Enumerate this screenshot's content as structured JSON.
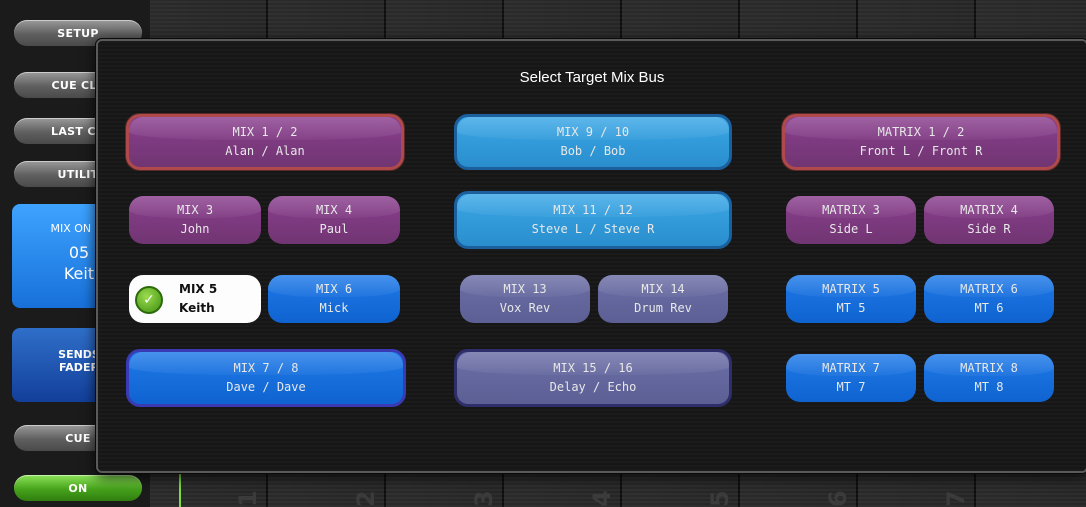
{
  "background": {
    "channel_numbers": [
      "1",
      "2",
      "3",
      "4",
      "5",
      "6",
      "7"
    ]
  },
  "sidebar": {
    "setup": "SETUP",
    "cue_clear": "CUE CLE",
    "last_cue": "LAST CU",
    "utility": "UTILIT",
    "mix_on_fader": {
      "line1": "MIX ON FA",
      "line2": "05",
      "line3": "Keit"
    },
    "sends_fader": {
      "line1": "SENDS",
      "line2": "FADER"
    },
    "cue": "CUE",
    "on": "ON"
  },
  "dialog": {
    "title": "Select Target Mix Bus",
    "buses": [
      {
        "id": "mix1-2",
        "name": "MIX 1 / 2",
        "label": "Alan / Alan",
        "color": "#7d3a80"
      },
      {
        "id": "mix9-10",
        "name": "MIX 9 / 10",
        "label": "Bob / Bob",
        "color": "#3aa7e6"
      },
      {
        "id": "matrix1-2",
        "name": "MATRIX 1 / 2",
        "label": "Front L / Front R",
        "color": "#7d3a80"
      },
      {
        "id": "mix3",
        "name": "MIX 3",
        "label": "John",
        "color": "#7d3a80"
      },
      {
        "id": "mix4",
        "name": "MIX 4",
        "label": "Paul",
        "color": "#7d3a80"
      },
      {
        "id": "mix11-12",
        "name": "MIX 11 / 12",
        "label": "Steve L / Steve R",
        "color": "#3aa7e6"
      },
      {
        "id": "matrix3",
        "name": "MATRIX 3",
        "label": "Side L",
        "color": "#7d3a80"
      },
      {
        "id": "matrix4",
        "name": "MATRIX 4",
        "label": "Side R",
        "color": "#7d3a80"
      },
      {
        "id": "mix5",
        "name": "MIX 5",
        "label": "Keith",
        "color": "#ffffff",
        "selected": true
      },
      {
        "id": "mix6",
        "name": "MIX 6",
        "label": "Mick",
        "color": "#1f7ae8"
      },
      {
        "id": "mix13",
        "name": "MIX 13",
        "label": "Vox Rev",
        "color": "#6c6fa6"
      },
      {
        "id": "mix14",
        "name": "MIX 14",
        "label": "Drum Rev",
        "color": "#6c6fa6"
      },
      {
        "id": "matrix5",
        "name": "MATRIX 5",
        "label": "MT 5",
        "color": "#1f7ae8"
      },
      {
        "id": "matrix6",
        "name": "MATRIX 6",
        "label": "MT 6",
        "color": "#1f7ae8"
      },
      {
        "id": "mix7-8",
        "name": "MIX 7 / 8",
        "label": "Dave / Dave",
        "color": "#1f7ae8"
      },
      {
        "id": "mix15-16",
        "name": "MIX 15 / 16",
        "label": "Delay / Echo",
        "color": "#6c6fa6"
      },
      {
        "id": "matrix7",
        "name": "MATRIX 7",
        "label": "MT 7",
        "color": "#1f7ae8"
      },
      {
        "id": "matrix8",
        "name": "MATRIX 8",
        "label": "MT 8",
        "color": "#1f7ae8"
      }
    ]
  }
}
